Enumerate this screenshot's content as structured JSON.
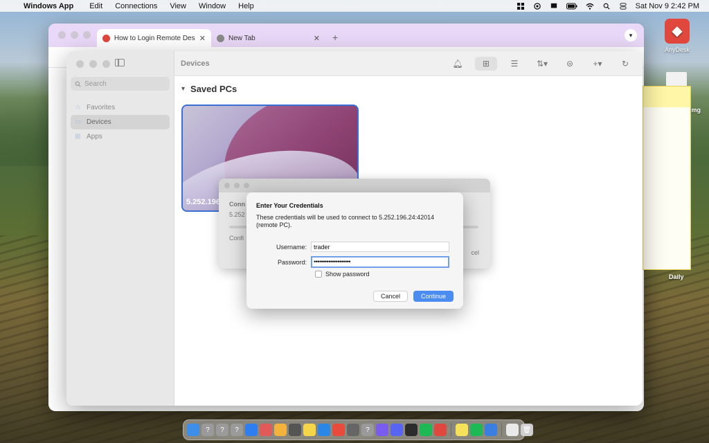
{
  "menubar": {
    "app_name": "Windows App",
    "menus": [
      "Edit",
      "Connections",
      "View",
      "Window",
      "Help"
    ],
    "datetime": "Sat Nov 9  2:42 PM"
  },
  "desktop": {
    "anydesk_label": "AnyDesk",
    "daily_label": "Daily",
    "img_label": "img"
  },
  "browser": {
    "tabs": [
      {
        "label": "How to Login Remote Desktop"
      },
      {
        "label": "New Tab"
      }
    ],
    "new_tab_symbol": "+",
    "close_symbol": "✕"
  },
  "winapp": {
    "toolbar_title": "Devices",
    "search_placeholder": "Search",
    "nav": [
      {
        "label": "Favorites"
      },
      {
        "label": "Devices"
      },
      {
        "label": "Apps"
      }
    ],
    "section_title": "Saved PCs",
    "pc_card_label": "5.252.196"
  },
  "connecting_dialog": {
    "line1": "Conn",
    "line2": "5.252",
    "line3": "Confi",
    "cancel": "cel"
  },
  "credentials_dialog": {
    "title": "Enter Your Credentials",
    "description": "These credentials will be used to connect to 5.252.196.24:42014 (remote PC).",
    "username_label": "Username:",
    "username_value": "trader",
    "password_label": "Password:",
    "password_value": "••••••••••••••••••••",
    "show_password_label": "Show password",
    "cancel_label": "Cancel",
    "continue_label": "Continue",
    "accent_color": "#4a8cf0"
  },
  "dock": {
    "apps": [
      {
        "icon": "finder-icon",
        "color": "#3d8ee8"
      },
      {
        "icon": "question-icon",
        "color": "#9a9a9a"
      },
      {
        "icon": "question-icon",
        "color": "#9a9a9a"
      },
      {
        "icon": "question-icon",
        "color": "#9a9a9a"
      },
      {
        "icon": "app-store-icon",
        "color": "#2f7ef0"
      },
      {
        "icon": "launchpad-icon",
        "color": "#e05a5a"
      },
      {
        "icon": "photos-icon",
        "color": "#f2b23c"
      },
      {
        "icon": "screenshot-icon",
        "color": "#555555"
      },
      {
        "icon": "notes-icon",
        "color": "#f5d64a"
      },
      {
        "icon": "safari-icon",
        "color": "#2a87e6"
      },
      {
        "icon": "chrome-icon",
        "color": "#e84b3c"
      },
      {
        "icon": "calculator-icon",
        "color": "#666666"
      },
      {
        "icon": "question-icon",
        "color": "#9a9a9a"
      },
      {
        "icon": "messenger-icon",
        "color": "#7b5cf0"
      },
      {
        "icon": "discord-icon",
        "color": "#5865f2"
      },
      {
        "icon": "robinhood-icon",
        "color": "#2c2c2c"
      },
      {
        "icon": "spotify-icon",
        "color": "#1db954"
      },
      {
        "icon": "anydesk-icon",
        "color": "#e0483e"
      },
      {
        "icon": "stickies-icon",
        "color": "#f5e15a"
      },
      {
        "icon": "spotify-icon",
        "color": "#1db954"
      },
      {
        "icon": "windows-app-icon",
        "color": "#3a7fe0"
      },
      {
        "icon": "document-icon",
        "color": "#e9e9e9"
      },
      {
        "icon": "trash-icon",
        "color": "#cfcfcf"
      }
    ]
  }
}
